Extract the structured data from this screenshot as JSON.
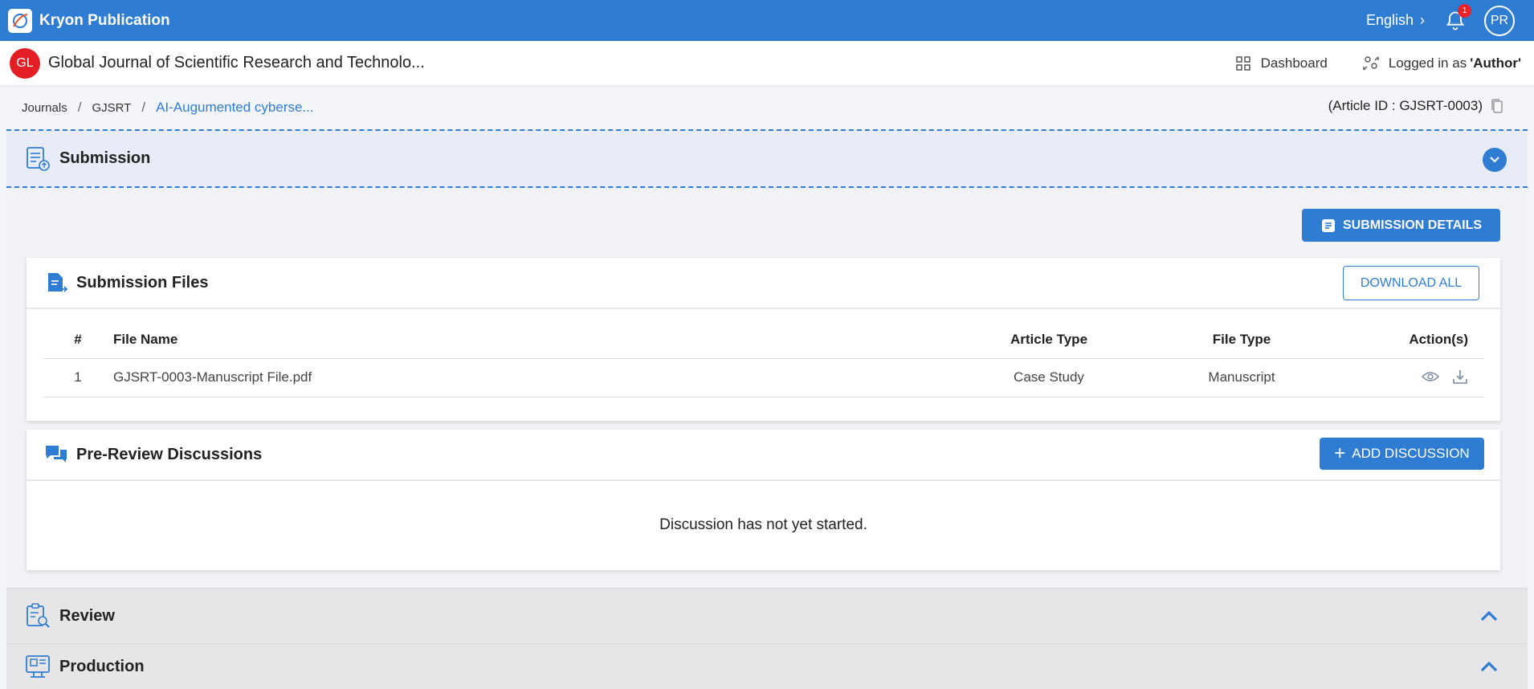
{
  "topbar": {
    "brand": "Kryon Publication",
    "language": "English",
    "notification_count": "1",
    "avatar_initials": "PR"
  },
  "journal": {
    "logo_initials": "GL",
    "title": "Global Journal of Scientific Research and Technolo...",
    "dashboard_label": "Dashboard",
    "logged_prefix": "Logged in as",
    "role": "'Author'"
  },
  "breadcrumb": {
    "items": [
      "Journals",
      "GJSRT",
      "AI-Augumented cyberse..."
    ],
    "article_id": "(Article ID : GJSRT-0003)"
  },
  "submission": {
    "title": "Submission",
    "details_button": "SUBMISSION DETAILS",
    "files": {
      "title": "Submission Files",
      "download_all": "DOWNLOAD ALL",
      "columns": [
        "#",
        "File Name",
        "Article Type",
        "File Type",
        "Action(s)"
      ],
      "rows": [
        {
          "num": "1",
          "name": "GJSRT-0003-Manuscript File.pdf",
          "article_type": "Case Study",
          "file_type": "Manuscript"
        }
      ]
    },
    "discussions": {
      "title": "Pre-Review Discussions",
      "add_button": "ADD DISCUSSION",
      "empty_message": "Discussion has not yet started."
    }
  },
  "sections": {
    "review": "Review",
    "production": "Production"
  },
  "colors": {
    "primary": "#2f7dd3",
    "badge": "#e8232b",
    "journal_logo": "#e41e25"
  }
}
